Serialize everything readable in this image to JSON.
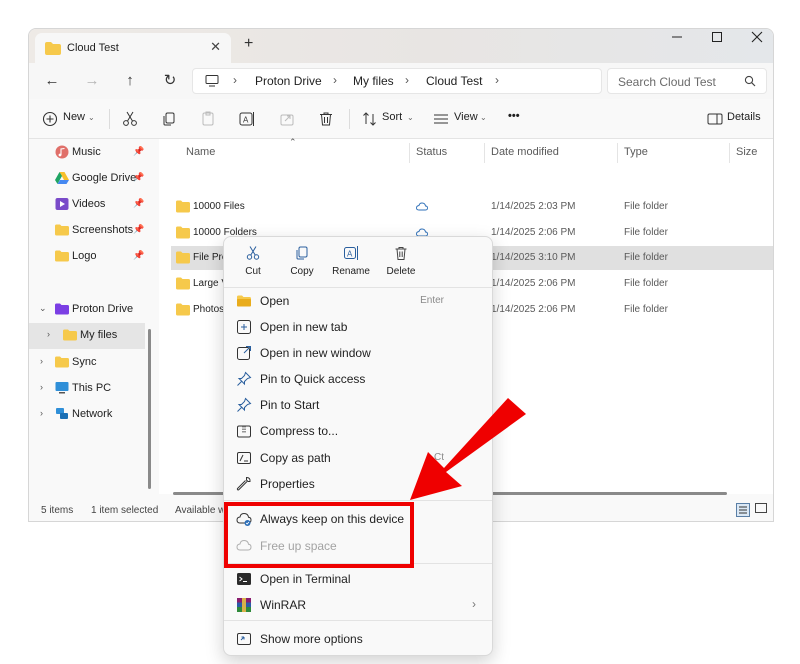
{
  "window": {
    "tab_title": "Cloud Test",
    "new_tab": "+",
    "close_tab": "✕"
  },
  "nav": {
    "back": "←",
    "forward": "→",
    "up": "↑",
    "refresh": "↻"
  },
  "breadcrumb": [
    "Proton Drive",
    "My files",
    "Cloud Test"
  ],
  "search": {
    "placeholder": "Search Cloud Test"
  },
  "commands": {
    "new": "New",
    "sort": "Sort",
    "view": "View",
    "more": "•••",
    "details": "Details"
  },
  "sidebar": {
    "items": [
      {
        "label": "Music",
        "icon": "music-icon",
        "pinned": true
      },
      {
        "label": "Google Drive",
        "icon": "google-drive-icon",
        "pinned": true
      },
      {
        "label": "Videos",
        "icon": "videos-icon",
        "pinned": true
      },
      {
        "label": "Screenshots",
        "icon": "folder-icon",
        "pinned": true
      },
      {
        "label": "Logo",
        "icon": "folder-icon",
        "pinned": true
      },
      {
        "label": "Proton Drive",
        "icon": "proton-drive-icon",
        "expanded": true
      },
      {
        "label": "My files",
        "icon": "folder-icon",
        "selected": true
      },
      {
        "label": "Sync",
        "icon": "folder-icon"
      },
      {
        "label": "This PC",
        "icon": "pc-icon"
      },
      {
        "label": "Network",
        "icon": "network-icon"
      }
    ]
  },
  "columns": [
    "Name",
    "Status",
    "Date modified",
    "Type",
    "Size"
  ],
  "files": [
    {
      "name": "10000 Files",
      "date": "1/14/2025 2:03 PM",
      "type": "File folder"
    },
    {
      "name": "10000 Folders",
      "date": "1/14/2025 2:06 PM",
      "type": "File folder"
    },
    {
      "name": "File Preview",
      "date": "1/14/2025 3:10 PM",
      "type": "File folder"
    },
    {
      "name": "Large V",
      "date": "1/14/2025 2:06 PM",
      "type": "File folder"
    },
    {
      "name": "Photos",
      "date": "1/14/2025 2:06 PM",
      "type": "File folder"
    }
  ],
  "status": {
    "items": "5 items",
    "selected": "1 item selected",
    "available": "Available w"
  },
  "context_menu": {
    "quick_actions": [
      "Cut",
      "Copy",
      "Rename",
      "Delete"
    ],
    "items": [
      {
        "label": "Open",
        "shortcut": "Enter",
        "icon": "folder-open-icon"
      },
      {
        "label": "Open in new tab",
        "icon": "new-tab-icon"
      },
      {
        "label": "Open in new window",
        "icon": "new-window-icon"
      },
      {
        "label": "Pin to Quick access",
        "icon": "pin-icon"
      },
      {
        "label": "Pin to Start",
        "icon": "pin-icon"
      },
      {
        "label": "Compress to...",
        "icon": "zip-icon"
      },
      {
        "label": "Copy as path",
        "shortcut": "Ct",
        "icon": "copy-path-icon"
      },
      {
        "label": "Properties",
        "shortcut": "nter",
        "icon": "wrench-icon"
      },
      {
        "label": "Always keep on this device",
        "icon": "cloud-keep-icon"
      },
      {
        "label": "Free up space",
        "icon": "cloud-icon",
        "disabled": true
      },
      {
        "label": "Open in Terminal",
        "icon": "terminal-icon"
      },
      {
        "label": "WinRAR",
        "icon": "winrar-icon",
        "submenu": true
      },
      {
        "label": "Show more options",
        "icon": "more-options-icon"
      }
    ]
  },
  "colors": {
    "folder": "#f6c94b",
    "accent": "#0067c0",
    "annotation": "#ef0000",
    "proton": "#7b3fe4"
  }
}
